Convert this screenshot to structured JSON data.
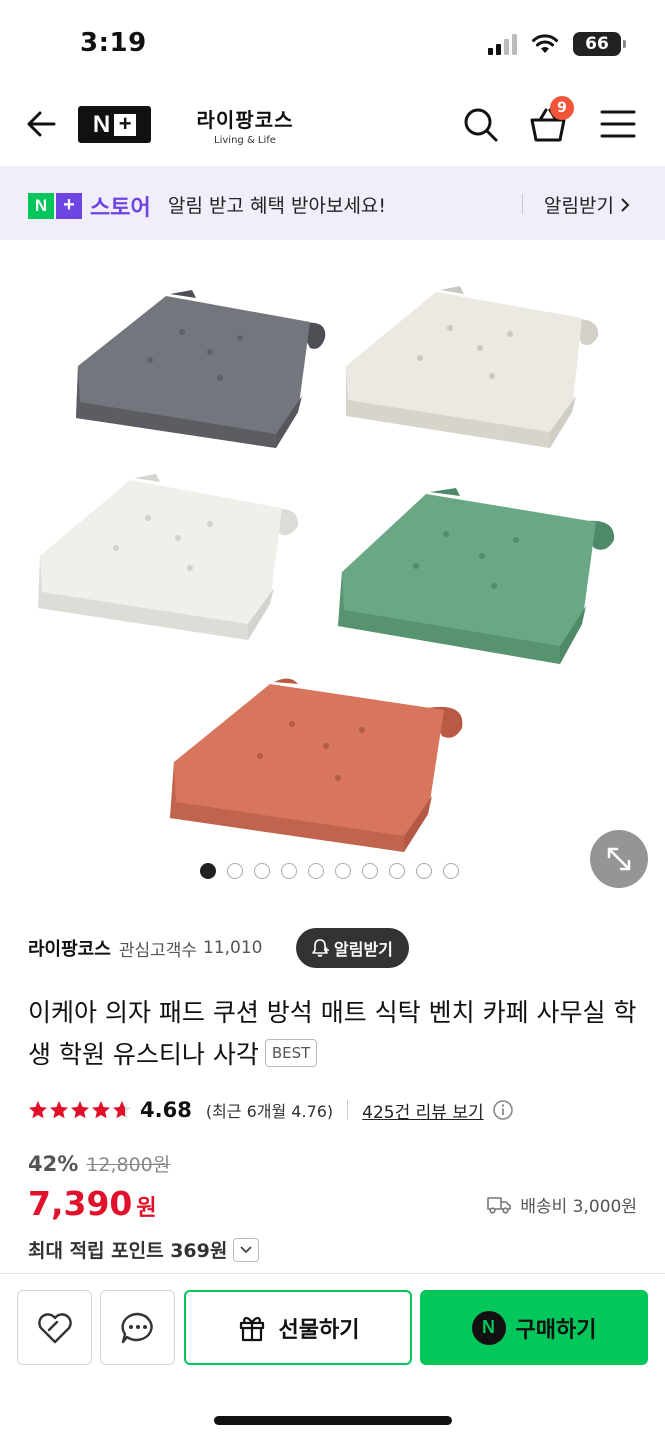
{
  "status_bar": {
    "time": "3:19",
    "battery": "66"
  },
  "header": {
    "naver_plus_logo": "N+",
    "brand_logo_ko": "라이팡코스",
    "brand_logo_en": "Living & Life",
    "cart_count": "9"
  },
  "promo": {
    "logo_text": "N+",
    "store_label": "스토어",
    "message": "알림 받고 혜택 받아보세요!",
    "action": "알림받기"
  },
  "gallery": {
    "image_count": 10,
    "active_index": 0,
    "variants": [
      {
        "name": "dark-gray",
        "color": "#6f7178"
      },
      {
        "name": "beige",
        "color": "#e6e4dc"
      },
      {
        "name": "off-white",
        "color": "#ecebe6"
      },
      {
        "name": "green",
        "color": "#6aa785"
      },
      {
        "name": "orange",
        "color": "#d7765d"
      }
    ]
  },
  "seller": {
    "name": "라이팡코스",
    "fans_label": "관심고객수",
    "fans_count": "11,010",
    "notify_label": "알림받기"
  },
  "product": {
    "title": "이케아 의자 패드 쿠션 방석 매트 식탁 벤치 카페 사무실 학생 학원 유스티나 사각",
    "badge": "BEST"
  },
  "rating": {
    "score": "4.68",
    "score_value": 4.68,
    "recent": "(최근 6개월 4.76)",
    "review_link": "425건 리뷰 보기"
  },
  "price": {
    "discount_rate": "42%",
    "original": "12,800원",
    "current": "7,390",
    "currency": "원",
    "shipping": "배송비 3,000원",
    "points": "최대 적립 포인트 369원"
  },
  "bottom_bar": {
    "gift_label": "선물하기",
    "buy_label": "구매하기",
    "buy_icon_letter": "N"
  },
  "colors": {
    "naver_green": "#03c75a",
    "price_red": "#e0112b",
    "store_purple": "#6e45e2",
    "badge_red": "#f2543a"
  }
}
